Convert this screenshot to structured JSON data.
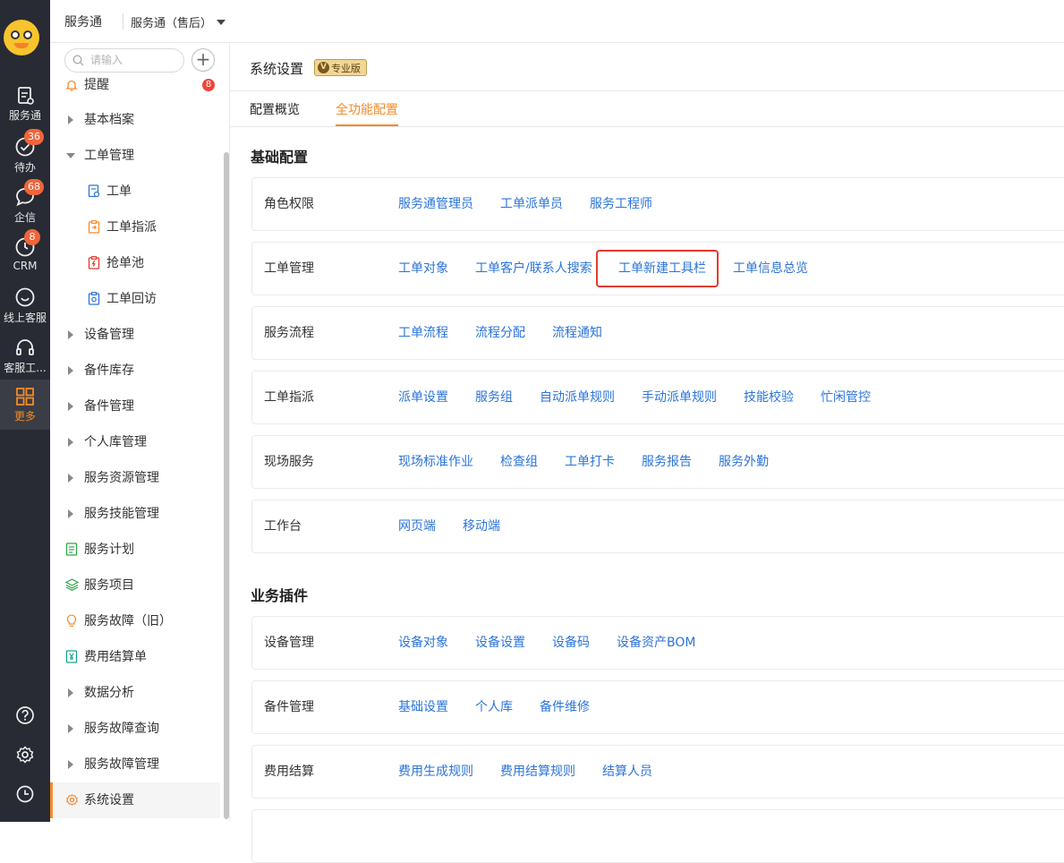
{
  "rail": {
    "items": [
      {
        "label": "服务通",
        "icon": "service-doc-icon"
      },
      {
        "label": "待办",
        "icon": "check-circle-icon",
        "badge": "36"
      },
      {
        "label": "企信",
        "icon": "chat-bubble-icon",
        "badge": "68"
      },
      {
        "label": "CRM",
        "icon": "clock-icon",
        "badge": "8"
      },
      {
        "label": "线上客服",
        "icon": "smile-chat-icon"
      },
      {
        "label": "客服工...",
        "icon": "headset-icon"
      },
      {
        "label": "更多",
        "icon": "grid-icon"
      }
    ],
    "bottom_icons": [
      "help-icon",
      "settings-icon",
      "history-clock-icon"
    ]
  },
  "topbar": {
    "app_name": "服务通",
    "product_select": "服务通（售后）"
  },
  "sidebar": {
    "search_placeholder": "请输入",
    "reminder": {
      "label": "提醒",
      "badge": "8"
    },
    "items": [
      {
        "label": "基本档案",
        "type": "collapsed"
      },
      {
        "label": "工单管理",
        "type": "expanded"
      },
      {
        "label": "工单",
        "type": "sub"
      },
      {
        "label": "工单指派",
        "type": "sub"
      },
      {
        "label": "抢单池",
        "type": "sub"
      },
      {
        "label": "工单回访",
        "type": "sub"
      },
      {
        "label": "设备管理",
        "type": "collapsed"
      },
      {
        "label": "备件库存",
        "type": "collapsed"
      },
      {
        "label": "备件管理",
        "type": "collapsed"
      },
      {
        "label": "个人库管理",
        "type": "collapsed"
      },
      {
        "label": "服务资源管理",
        "type": "collapsed"
      },
      {
        "label": "服务技能管理",
        "type": "collapsed"
      },
      {
        "label": "服务计划",
        "type": "icon"
      },
      {
        "label": "服务项目",
        "type": "icon"
      },
      {
        "label": "服务故障（旧）",
        "type": "icon"
      },
      {
        "label": "费用结算单",
        "type": "icon"
      },
      {
        "label": "数据分析",
        "type": "collapsed"
      },
      {
        "label": "服务故障查询",
        "type": "collapsed"
      },
      {
        "label": "服务故障管理",
        "type": "collapsed"
      },
      {
        "label": "系统设置",
        "type": "active"
      }
    ]
  },
  "main": {
    "title": "系统设置",
    "edition_badge": "专业版",
    "tabs": [
      {
        "label": "配置概览",
        "active": false
      },
      {
        "label": "全功能配置",
        "active": true
      }
    ],
    "sections": [
      {
        "title": "基础配置",
        "rows": [
          {
            "label": "角色权限",
            "links": [
              "服务通管理员",
              "工单派单员",
              "服务工程师"
            ]
          },
          {
            "label": "工单管理",
            "links": [
              "工单对象",
              "工单客户/联系人搜索",
              "工单新建工具栏",
              "工单信息总览"
            ]
          },
          {
            "label": "服务流程",
            "links": [
              "工单流程",
              "流程分配",
              "流程通知"
            ]
          },
          {
            "label": "工单指派",
            "links": [
              "派单设置",
              "服务组",
              "自动派单规则",
              "手动派单规则",
              "技能校验",
              "忙闲管控"
            ]
          },
          {
            "label": "现场服务",
            "links": [
              "现场标准作业",
              "检查组",
              "工单打卡",
              "服务报告",
              "服务外勤"
            ]
          },
          {
            "label": "工作台",
            "links": [
              "网页端",
              "移动端"
            ]
          }
        ]
      },
      {
        "title": "业务插件",
        "rows": [
          {
            "label": "设备管理",
            "links": [
              "设备对象",
              "设备设置",
              "设备码",
              "设备资产BOM"
            ]
          },
          {
            "label": "备件管理",
            "links": [
              "基础设置",
              "个人库",
              "备件维修"
            ]
          },
          {
            "label": "费用结算",
            "links": [
              "费用生成规则",
              "费用结算规则",
              "结算人员"
            ]
          }
        ]
      }
    ]
  },
  "colors": {
    "accent": "#f58a2a",
    "link": "#2b74d9",
    "rail_bg": "#282b33",
    "badge": "#f0453b",
    "highlight": "#e23b2e"
  }
}
